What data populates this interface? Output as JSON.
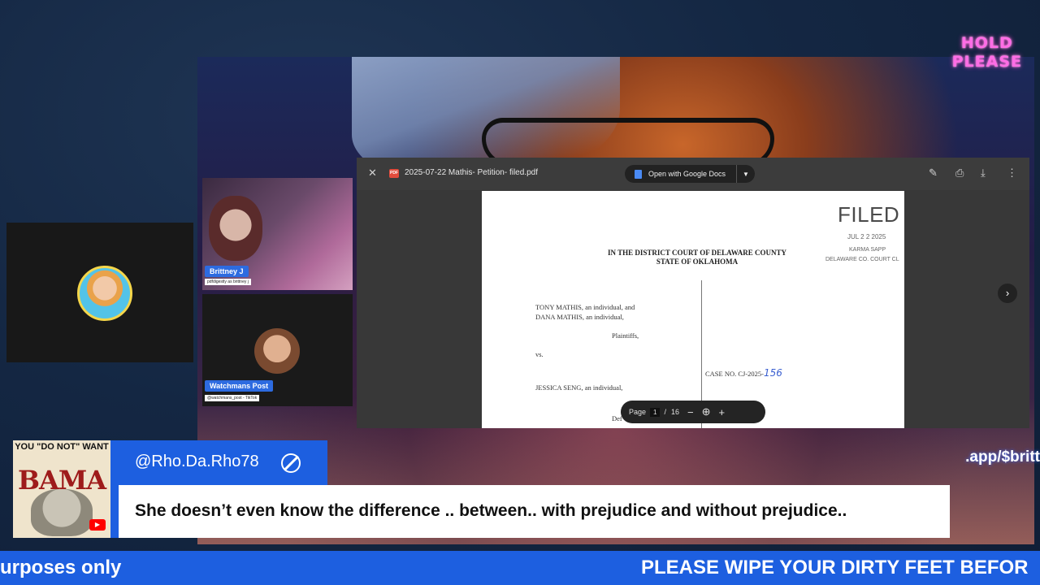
{
  "overlay": {
    "hold_line1": "HOLD",
    "hold_line2": "PLEASE",
    "url_fragment": ".app/$britt"
  },
  "participants": [
    {
      "name": "Brittney J",
      "sub": "pdfdigestly as brittney j"
    },
    {
      "name": "Watchmans Post",
      "sub": "@watchmans_post - TikTok"
    }
  ],
  "pdf_viewer": {
    "filename": "2025-07-22 Mathis- Petition- filed.pdf",
    "open_with": "Open with Google Docs",
    "page_label": "Page",
    "current_page": "1",
    "separator": "/",
    "total_pages": "16",
    "document": {
      "stamp": "FILED",
      "stamp_date": "JUL  2 2 2025",
      "stamp_clerk": "KARMA SAPP",
      "stamp_office": "DELAWARE CO. COURT CL",
      "court_line1": "IN THE DISTRICT COURT OF DELAWARE COUNTY",
      "court_line2": "STATE OF OKLAHOMA",
      "plaintiff_line1": "TONY MATHIS, an individual, and",
      "plaintiff_line2": "DANA MATHIS, an individual,",
      "plaintiffs_label": "Plaintiffs,",
      "vs": "vs.",
      "defendant": "JESSICA SENG, an individual,",
      "defendant_label": "Def",
      "case_no": "CASE NO. CJ-2025-",
      "case_no_hand": "156"
    }
  },
  "chat": {
    "avatar_top": "YOU \"DO NOT\" WANT",
    "avatar_big": "BAMA",
    "username": "@Rho.Da.Rho78",
    "message": "She doesn’t even know the difference .. between.. with prejudice and without prejudice.."
  },
  "ticker": {
    "left_text": "urposes only",
    "right_text": "PLEASE WIPE YOUR DIRTY FEET BEFOR"
  }
}
